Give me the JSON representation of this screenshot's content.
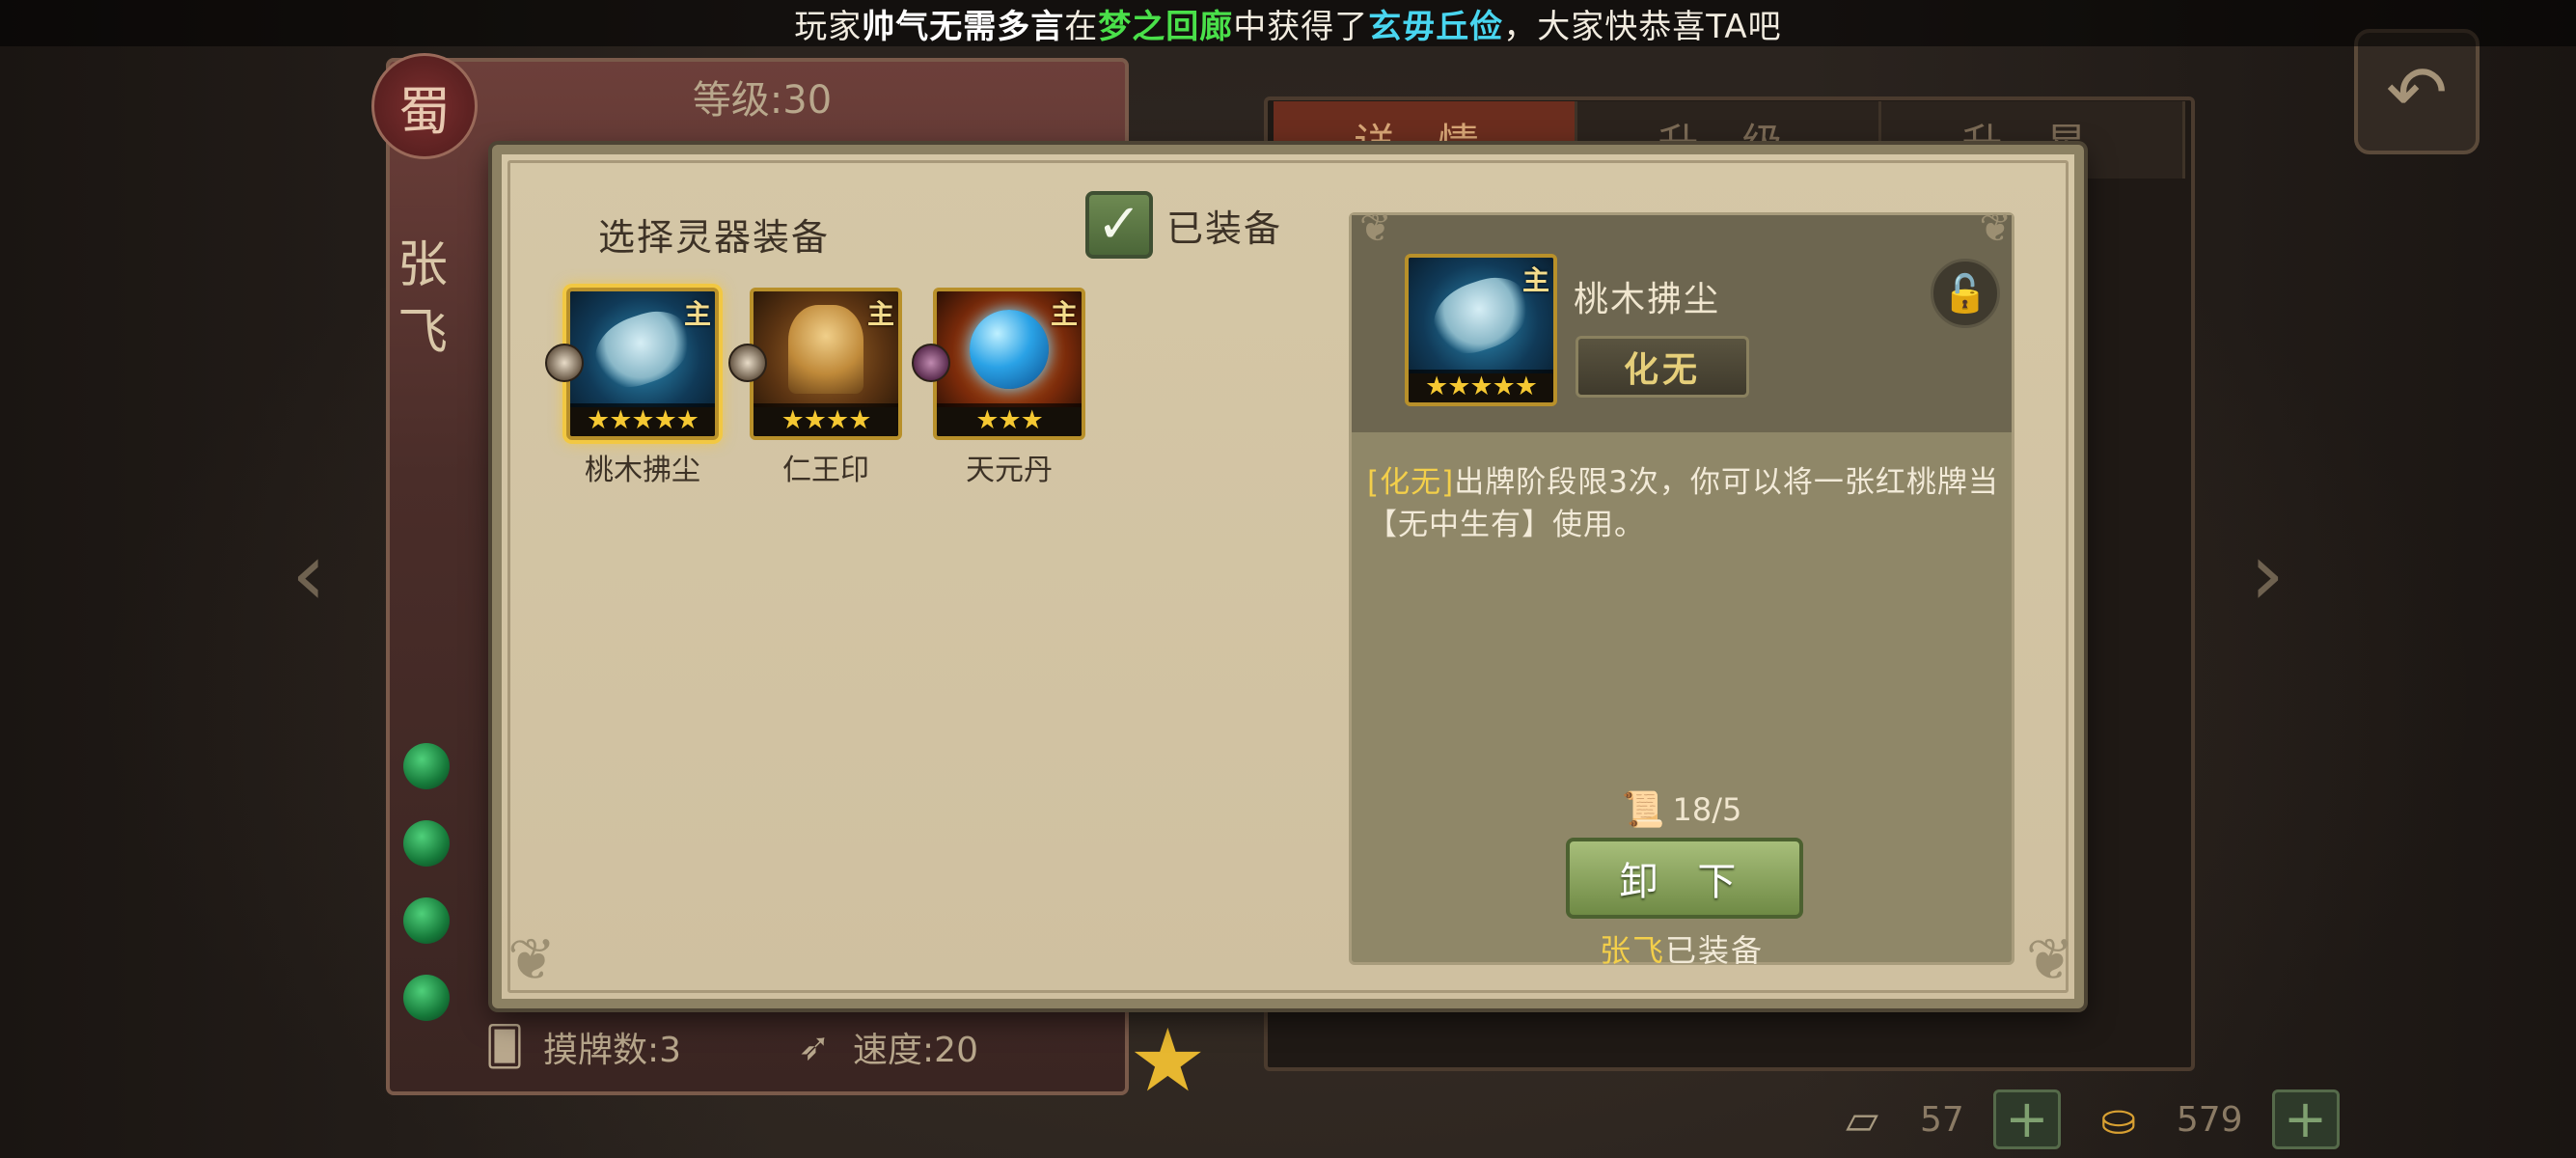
{
  "marquee": {
    "prefix": "玩家",
    "player": "帅气无需多言",
    "mid": "在",
    "location": "梦之回廊",
    "mid2": "中获得了",
    "item": "玄毋丘俭",
    "suffix": "，大家快恭喜TA吧"
  },
  "hero": {
    "level": "等级:30",
    "name": "张飞",
    "kingdom_glyph": "蜀",
    "draw_label": "摸牌数:3",
    "speed_label": "速度:20"
  },
  "background_tabs": [
    "详 情",
    "升 级",
    "升 星"
  ],
  "currency": {
    "scrolls": "57",
    "ingots": "579"
  },
  "dialog": {
    "section_title": "选择灵器装备",
    "filter_label": "已装备",
    "filter_checked": true,
    "items": [
      {
        "name": "桃木拂尘",
        "stars": "★★★★★",
        "badge": "主",
        "art": "whisk",
        "selected": true
      },
      {
        "name": "仁王印",
        "stars": "★★★★",
        "badge": "主",
        "art": "seal",
        "selected": false
      },
      {
        "name": "天元丹",
        "stars": "★★★",
        "badge": "主",
        "art": "pill",
        "selected": false
      }
    ],
    "detail": {
      "name": "桃木拂尘",
      "stars": "★★★★★",
      "badge": "主",
      "skill_chip": "化无",
      "skill_keyword": "[化无]",
      "skill_text": "出牌阶段限3次，你可以将一张红桃牌当【无中生有】使用。",
      "progress": "18/5",
      "unequip_label": "卸 下",
      "equipped_hero": "张飞",
      "equipped_suffix": "已装备"
    }
  },
  "colors": {
    "dialog_bg": "#d5c7a6",
    "detail_bg": "#8f8768",
    "accent_gold": "#f3cf4a",
    "button_green": "#6f8a45"
  }
}
